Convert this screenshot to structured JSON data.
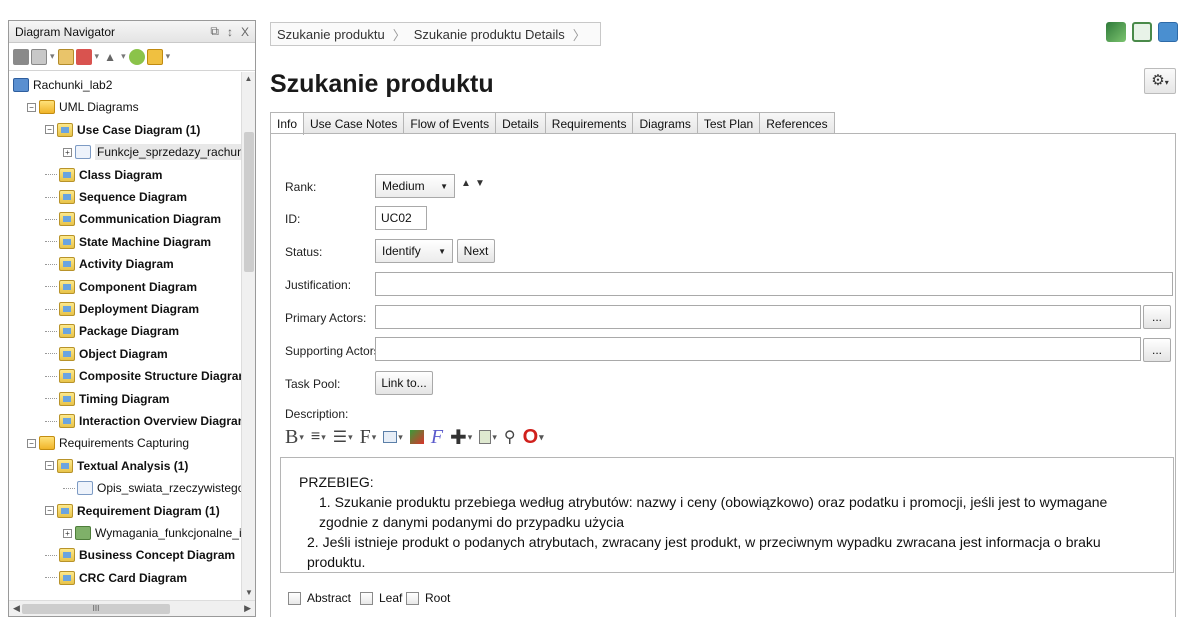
{
  "navigator": {
    "title": "Diagram Navigator",
    "controls": [
      "⧉",
      "↕",
      "X"
    ],
    "tree": [
      {
        "label": "Rachunki_lab2",
        "icon": "project-icon",
        "depth": 0
      },
      {
        "label": "UML Diagrams",
        "icon": "folder-icon",
        "depth": 1
      },
      {
        "label": "Use Case Diagram (1)",
        "icon": "diagram-icon",
        "depth": 2,
        "bold": true
      },
      {
        "label": "Funkcje_sprzedazy_rachunkow",
        "icon": "file-icon",
        "depth": 3,
        "selected": true
      },
      {
        "label": "Class Diagram",
        "icon": "diagram-icon",
        "depth": 2,
        "bold": true
      },
      {
        "label": "Sequence Diagram",
        "icon": "diagram-icon",
        "depth": 2,
        "bold": true
      },
      {
        "label": "Communication Diagram",
        "icon": "diagram-icon",
        "depth": 2,
        "bold": true
      },
      {
        "label": "State Machine Diagram",
        "icon": "diagram-icon",
        "depth": 2,
        "bold": true
      },
      {
        "label": "Activity Diagram",
        "icon": "diagram-icon",
        "depth": 2,
        "bold": true
      },
      {
        "label": "Component Diagram",
        "icon": "diagram-icon",
        "depth": 2,
        "bold": true
      },
      {
        "label": "Deployment Diagram",
        "icon": "diagram-icon",
        "depth": 2,
        "bold": true
      },
      {
        "label": "Package Diagram",
        "icon": "diagram-icon",
        "depth": 2,
        "bold": true
      },
      {
        "label": "Object Diagram",
        "icon": "diagram-icon",
        "depth": 2,
        "bold": true
      },
      {
        "label": "Composite Structure Diagram",
        "icon": "diagram-icon",
        "depth": 2,
        "bold": true
      },
      {
        "label": "Timing Diagram",
        "icon": "diagram-icon",
        "depth": 2,
        "bold": true
      },
      {
        "label": "Interaction Overview Diagram",
        "icon": "diagram-icon",
        "depth": 2,
        "bold": true
      },
      {
        "label": "Requirements Capturing",
        "icon": "folder-icon",
        "depth": 1
      },
      {
        "label": "Textual Analysis (1)",
        "icon": "diagram-icon",
        "depth": 2,
        "bold": true
      },
      {
        "label": "Opis_swiata_rzeczywistego",
        "icon": "file-icon",
        "depth": 3
      },
      {
        "label": "Requirement Diagram (1)",
        "icon": "diagram-icon",
        "depth": 2,
        "bold": true
      },
      {
        "label": "Wymagania_funkcjonalne_i_nief",
        "icon": "requirement-icon",
        "depth": 3
      },
      {
        "label": "Business Concept Diagram",
        "icon": "diagram-icon",
        "depth": 2,
        "bold": true
      },
      {
        "label": "CRC Card Diagram",
        "icon": "diagram-icon",
        "depth": 2,
        "bold": true
      }
    ]
  },
  "breadcrumb": {
    "items": [
      "Szukanie produktu",
      "Szukanie produktu Details"
    ]
  },
  "page": {
    "title": "Szukanie produktu"
  },
  "tabs": [
    "Info",
    "Use Case Notes",
    "Flow of Events",
    "Details",
    "Requirements",
    "Diagrams",
    "Test Plan",
    "References"
  ],
  "form": {
    "rank_label": "Rank:",
    "rank_value": "Medium",
    "id_label": "ID:",
    "id_value": "UC02",
    "status_label": "Status:",
    "status_value": "Identify",
    "next_button": "Next",
    "justification_label": "Justification:",
    "justification_value": "",
    "primary_actors_label": "Primary Actors:",
    "supporting_actors_label": "Supporting Actors:",
    "browse_button": "...",
    "task_pool_label": "Task Pool:",
    "link_button": "Link to...",
    "description_label": "Description:"
  },
  "description": {
    "heading": "PRZEBIEG:",
    "step1_num": "1.",
    "step1_text": "Szukanie produktu przebiega według atrybutów: nazwy i ceny (obowiązkowo) oraz podatku i promocji, jeśli jest to wymagane zgodnie z danymi podanymi do przypadku użycia",
    "step2_num": "2.",
    "step2_text": "Jeśli istnieje produkt o podanych atrybutach, zwracany jest produkt, w przeciwnym wypadku zwracana jest informacja o braku produktu."
  },
  "checkboxes": [
    "Abstract",
    "Leaf",
    "Root"
  ],
  "colors": {
    "accent": "#f0b429",
    "border": "#b5b5b5",
    "title": "#1a1a1a"
  }
}
